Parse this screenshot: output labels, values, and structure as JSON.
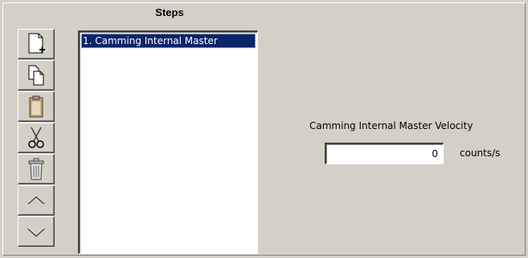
{
  "steps_panel": {
    "header": "Steps",
    "items": [
      {
        "label": "1. Camming Internal Master",
        "selected": true
      }
    ]
  },
  "toolbar": {
    "buttons": [
      {
        "icon": "new-document-icon"
      },
      {
        "icon": "copy-icon"
      },
      {
        "icon": "paste-icon"
      },
      {
        "icon": "cut-icon"
      },
      {
        "icon": "delete-icon"
      },
      {
        "icon": "move-up-icon"
      },
      {
        "icon": "move-down-icon"
      }
    ]
  },
  "velocity": {
    "label": "Camming Internal Master Velocity",
    "value": "0",
    "units": "counts/s"
  },
  "colors": {
    "background": "#d4d0c8",
    "selection": "#0a246a"
  }
}
